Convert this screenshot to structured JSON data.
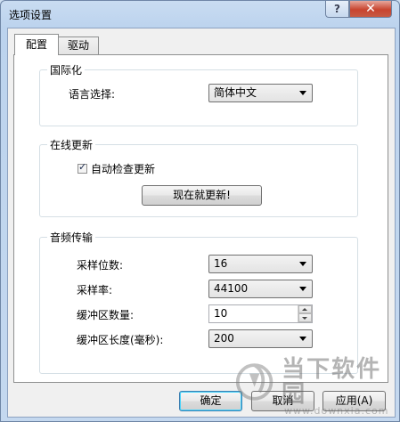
{
  "window": {
    "title": "选项设置"
  },
  "titlebar": {
    "help_label": "?",
    "close_label": "✕"
  },
  "tabs": [
    {
      "label": "配置",
      "selected": true
    },
    {
      "label": "驱动",
      "selected": false
    }
  ],
  "i18n": {
    "legend": "国际化",
    "language_label": "语言选择:",
    "language_value": "简体中文"
  },
  "online_update": {
    "legend": "在线更新",
    "auto_check_label": "自动检查更新",
    "auto_check_checked": true,
    "update_now_label": "现在就更新!"
  },
  "audio": {
    "legend": "音频传输",
    "bits_label": "采样位数:",
    "bits_value": "16",
    "rate_label": "采样率:",
    "rate_value": "44100",
    "buffer_count_label": "缓冲区数量:",
    "buffer_count_value": "10",
    "buffer_length_label": "缓冲区长度(毫秒):",
    "buffer_length_value": "200"
  },
  "footer": {
    "ok_label": "确定",
    "cancel_label": "取消",
    "apply_label": "应用(A)"
  },
  "watermark": {
    "text_cn": "当下软件园",
    "url": "www.downxia.com"
  }
}
